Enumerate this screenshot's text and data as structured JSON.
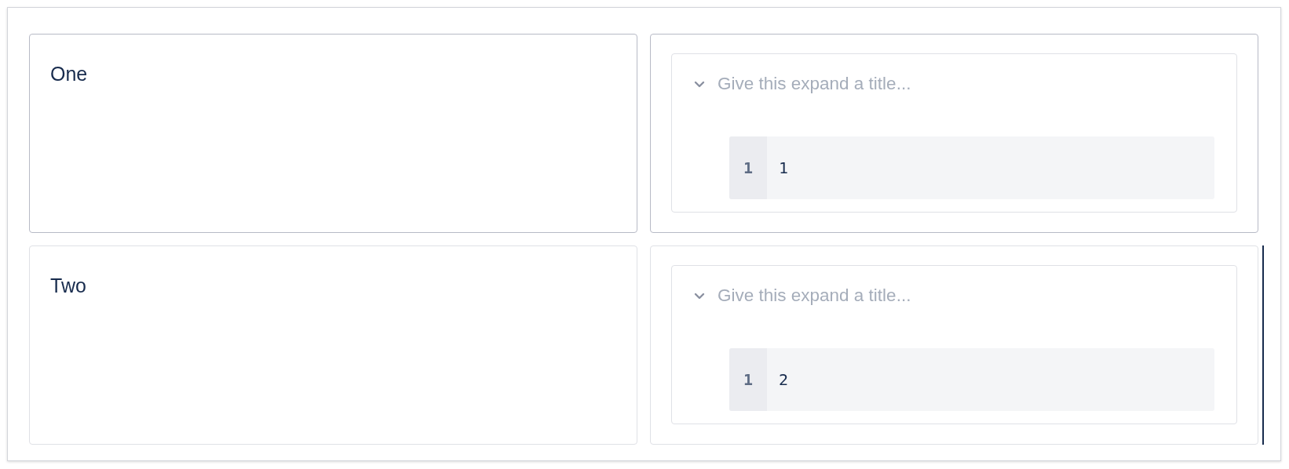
{
  "table": {
    "rows": [
      {
        "selected": true,
        "cells": [
          {
            "kind": "text",
            "text": "One"
          },
          {
            "kind": "expand",
            "placeholder": "Give this expand a title...",
            "expanded": true,
            "code": [
              {
                "line_number": "1",
                "text": "1"
              }
            ]
          }
        ]
      },
      {
        "selected": false,
        "resize_handle": true,
        "cells": [
          {
            "kind": "text",
            "text": "Two"
          },
          {
            "kind": "expand",
            "placeholder": "Give this expand a title...",
            "expanded": true,
            "code": [
              {
                "line_number": "1",
                "text": "2"
              }
            ]
          }
        ]
      }
    ]
  }
}
